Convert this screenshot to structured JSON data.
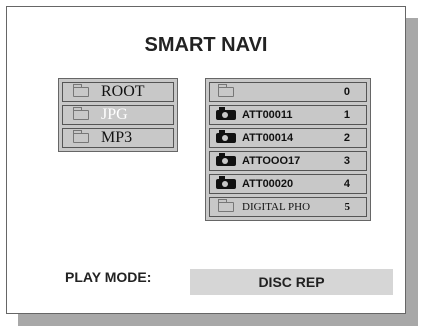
{
  "title": "SMART NAVI",
  "left_list": [
    {
      "label": "ROOT",
      "selected": false
    },
    {
      "label": "JPG",
      "selected": true
    },
    {
      "label": "MP3",
      "selected": false
    }
  ],
  "right_list": [
    {
      "icon": "folder-icon",
      "name": "",
      "index": "0"
    },
    {
      "icon": "camera-icon",
      "name": "ATT00011",
      "index": "1"
    },
    {
      "icon": "camera-icon",
      "name": "ATT00014",
      "index": "2"
    },
    {
      "icon": "camera-icon",
      "name": "ATTOOO17",
      "index": "3"
    },
    {
      "icon": "camera-icon",
      "name": "ATT00020",
      "index": "4"
    },
    {
      "icon": "folder-icon",
      "name": "DIGITAL PHO",
      "index": "5"
    }
  ],
  "play_mode": {
    "label": "PLAY MODE:",
    "value": "DISC REP"
  },
  "colors": {
    "panel_bg": "#ffffff",
    "list_bg": "#c8c8c8",
    "shadow": "#a8a8a8",
    "value_bg": "#d6d6d6"
  }
}
